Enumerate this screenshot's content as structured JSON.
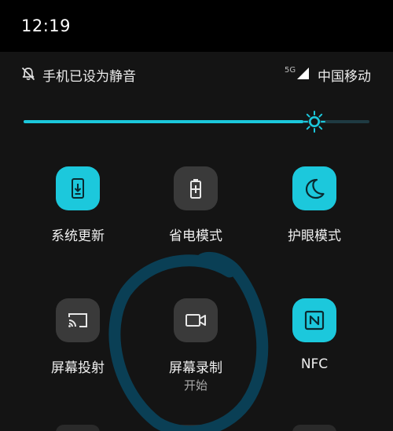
{
  "status_bar": {
    "time": "12:19"
  },
  "notification_row": {
    "mute_text": "手机已设为静音",
    "network_badge": "5G",
    "carrier": "中国移动"
  },
  "brightness": {
    "level": 0.84
  },
  "tiles": [
    {
      "label": "系统更新",
      "icon": "system-update-icon",
      "state": "on"
    },
    {
      "label": "省电模式",
      "icon": "battery-saver-icon",
      "state": "off"
    },
    {
      "label": "护眼模式",
      "icon": "moon-icon",
      "state": "on"
    },
    {
      "label": "屏幕投射",
      "icon": "cast-icon",
      "state": "off"
    },
    {
      "label": "屏幕录制",
      "sublabel": "开始",
      "icon": "video-camera-icon",
      "state": "off"
    },
    {
      "label": "NFC",
      "icon": "nfc-icon",
      "state": "on"
    }
  ],
  "colors": {
    "accent": "#1cc8dc",
    "tile_off": "#3a3a3a",
    "annotation": "#0a3f55"
  }
}
